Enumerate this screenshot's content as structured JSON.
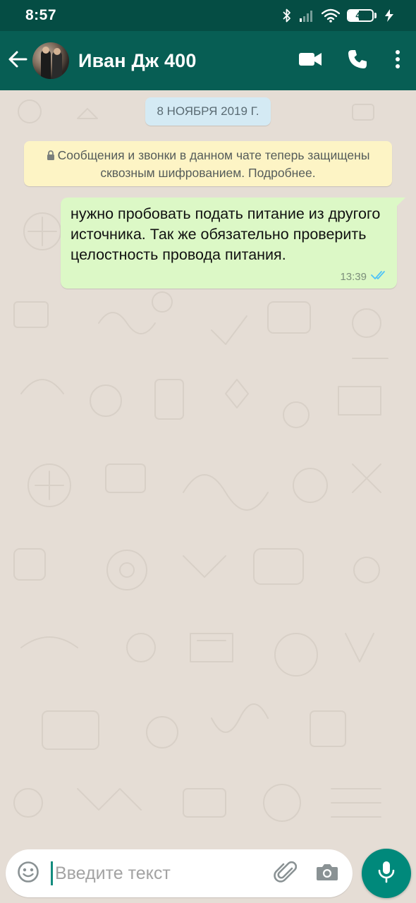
{
  "status_bar": {
    "time": "8:57",
    "battery": "44",
    "battery_percent": 44,
    "icons": [
      "bluetooth-icon",
      "signal-icon",
      "wifi-icon",
      "battery-icon",
      "charging-icon"
    ]
  },
  "header": {
    "contact_name": "Иван Дж 400",
    "icons": [
      "back-arrow-icon",
      "video-call-icon",
      "phone-icon",
      "more-vert-icon"
    ]
  },
  "chat": {
    "date_chip": "8 НОЯБРЯ 2019 Г.",
    "encryption_notice": "Сообщения и звонки в данном чате теперь защищены сквозным шифрованием. Подробнее.",
    "messages": [
      {
        "direction": "outgoing",
        "text": "нужно пробовать подать питание из другого источника. Так же обязательно проверить целостность провода питания.",
        "time": "13:39",
        "status": "read"
      }
    ]
  },
  "composer": {
    "placeholder": "Введите текст",
    "icons": [
      "emoji-icon",
      "attach-icon",
      "camera-icon",
      "mic-icon"
    ]
  },
  "colors": {
    "app_bar": "#075e54",
    "status_bar": "#054d44",
    "chat_bg": "#e5ddd5",
    "outgoing_bubble": "#dcf8c6",
    "date_chip": "#d4eaf4",
    "notice": "#fdf4c5",
    "accent": "#00897b",
    "read_ticks": "#4fc3f7"
  }
}
